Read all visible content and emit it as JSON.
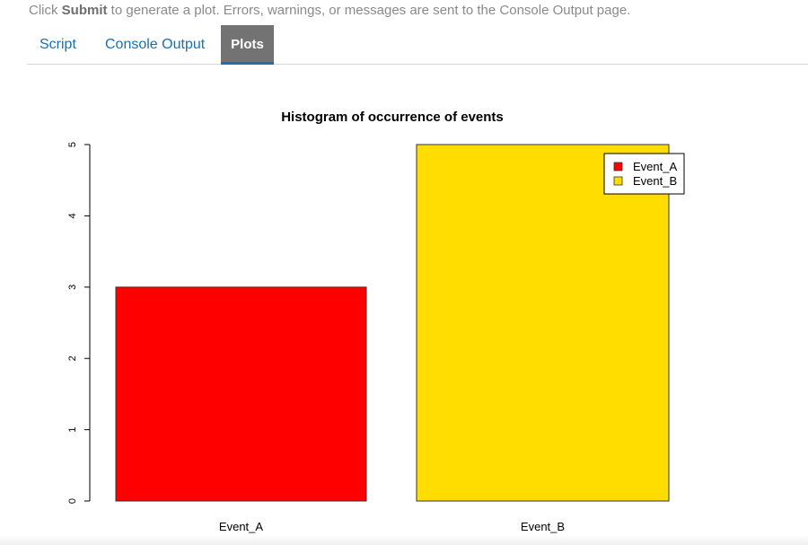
{
  "instructions": {
    "prefix": "Click ",
    "bold": "Submit",
    "suffix": " to generate a plot. Errors, warnings, or messages are sent to the Console Output page."
  },
  "tabs": [
    {
      "label": "Script",
      "active": false
    },
    {
      "label": "Console Output",
      "active": false
    },
    {
      "label": "Plots",
      "active": true
    }
  ],
  "colors": {
    "link": "#1a6fb0",
    "active_tab_bg": "#737373",
    "bar_event_a": "#ff0000",
    "bar_event_b": "#ffdd00"
  },
  "chart_data": {
    "type": "bar",
    "title": "Histogram of occurrence of events",
    "xlabel": "",
    "ylabel": "",
    "categories": [
      "Event_A",
      "Event_B"
    ],
    "values": [
      3,
      5
    ],
    "colors": [
      "#ff0000",
      "#ffdd00"
    ],
    "ylim": [
      0,
      5
    ],
    "yticks": [
      "0",
      "1",
      "2",
      "3",
      "4",
      "5"
    ],
    "grid": false,
    "legend": {
      "position": "top-right",
      "entries": [
        "Event_A",
        "Event_B"
      ]
    }
  }
}
